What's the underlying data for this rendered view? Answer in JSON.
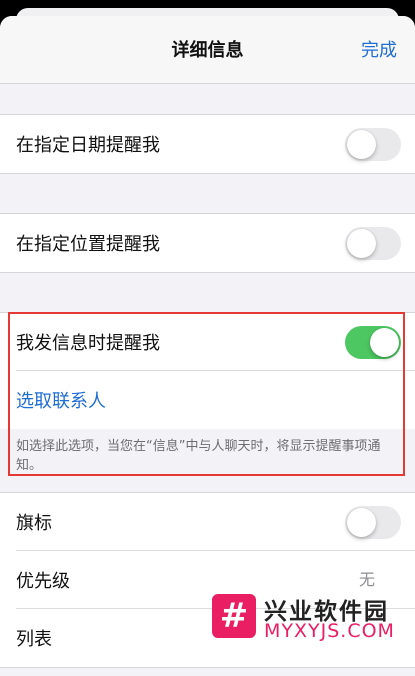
{
  "navbar": {
    "title": "详细信息",
    "done_label": "完成"
  },
  "date_reminder": {
    "label": "在指定日期提醒我",
    "enabled": false
  },
  "location_reminder": {
    "label": "在指定位置提醒我",
    "enabled": false
  },
  "messaging": {
    "label": "我发信息时提醒我",
    "enabled": true,
    "choose_contact": "选取联系人",
    "hint": "如选择此选项，当您在“信息”中与人聊天时，将显示提醒事项通知。"
  },
  "extras": {
    "flag_label": "旗标",
    "flag_enabled": false,
    "priority_label": "优先级",
    "priority_value": "无",
    "list_label": "列表"
  },
  "watermark": {
    "title": "兴业软件园",
    "url": "MYXYJS.COM",
    "logo_glyph": "#"
  },
  "colors": {
    "accent": "#1e6ed4",
    "toggle_on": "#4cc761",
    "highlight": "#e53935"
  }
}
